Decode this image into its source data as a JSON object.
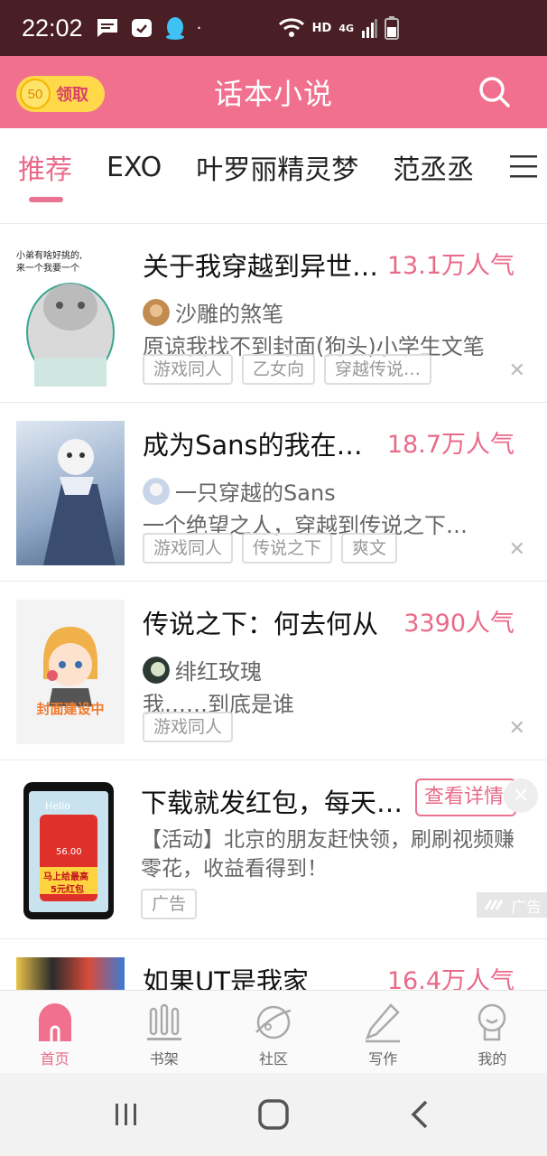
{
  "status_bar": {
    "time": "22:02",
    "network_hd": "HD",
    "network_gen": "4G"
  },
  "header": {
    "coin_value": "50",
    "coin_label": "领取",
    "title": "话本小说"
  },
  "tabs": [
    "推荐",
    "EXO",
    "叶罗丽精灵梦",
    "范丞丞"
  ],
  "items": [
    {
      "title": "关于我穿越到异世界…",
      "popularity": "13.1万人气",
      "author": "沙雕的煞笔",
      "desc": "原谅我找不到封面(狗头)小学生文笔",
      "tags": [
        "游戏同人",
        "乙女向",
        "穿越传说…"
      ],
      "cover_text": [
        "小弟有啥好挑的,",
        "来一个我要一个"
      ]
    },
    {
      "title": "成为Sans的我在…",
      "popularity": "18.7万人气",
      "author": "一只穿越的Sans",
      "desc": "一个绝望之人，穿越到传说之下…",
      "tags": [
        "游戏同人",
        "传说之下",
        "爽文"
      ]
    },
    {
      "title": "传说之下：何去何从",
      "popularity": "3390人气",
      "author": "绯红玫瑰",
      "desc": "我……到底是谁",
      "tags": [
        "游戏同人"
      ],
      "cover_text": [
        "封面建设中"
      ]
    }
  ],
  "ad": {
    "title": "下载就发红包，每天…",
    "button": "查看详情",
    "text": "【活动】北京的朋友赶快领，刷刷视频赚零花，收益看得到！",
    "tag": "广告",
    "mark": "广告",
    "cover_text": [
      "Hello",
      "56.00",
      "马上给最高",
      "5元红包"
    ]
  },
  "partial_item": {
    "title": "如果UT是我家",
    "popularity": "16.4万人气"
  },
  "bottom_nav": [
    "首页",
    "书架",
    "社区",
    "写作",
    "我的"
  ]
}
